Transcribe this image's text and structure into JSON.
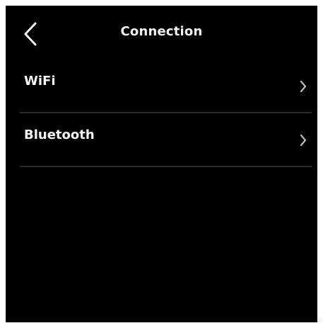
{
  "header": {
    "title": "Connection",
    "back_icon": "chevron-left-icon"
  },
  "menu": {
    "items": [
      {
        "label": "WiFi",
        "icon": "chevron-right-icon"
      },
      {
        "label": "Bluetooth",
        "icon": "chevron-right-icon"
      }
    ]
  },
  "colors": {
    "background": "#000000",
    "text": "#f5f5f5",
    "divider": "#2a2a2a",
    "chevron": "#bdbdbd"
  }
}
